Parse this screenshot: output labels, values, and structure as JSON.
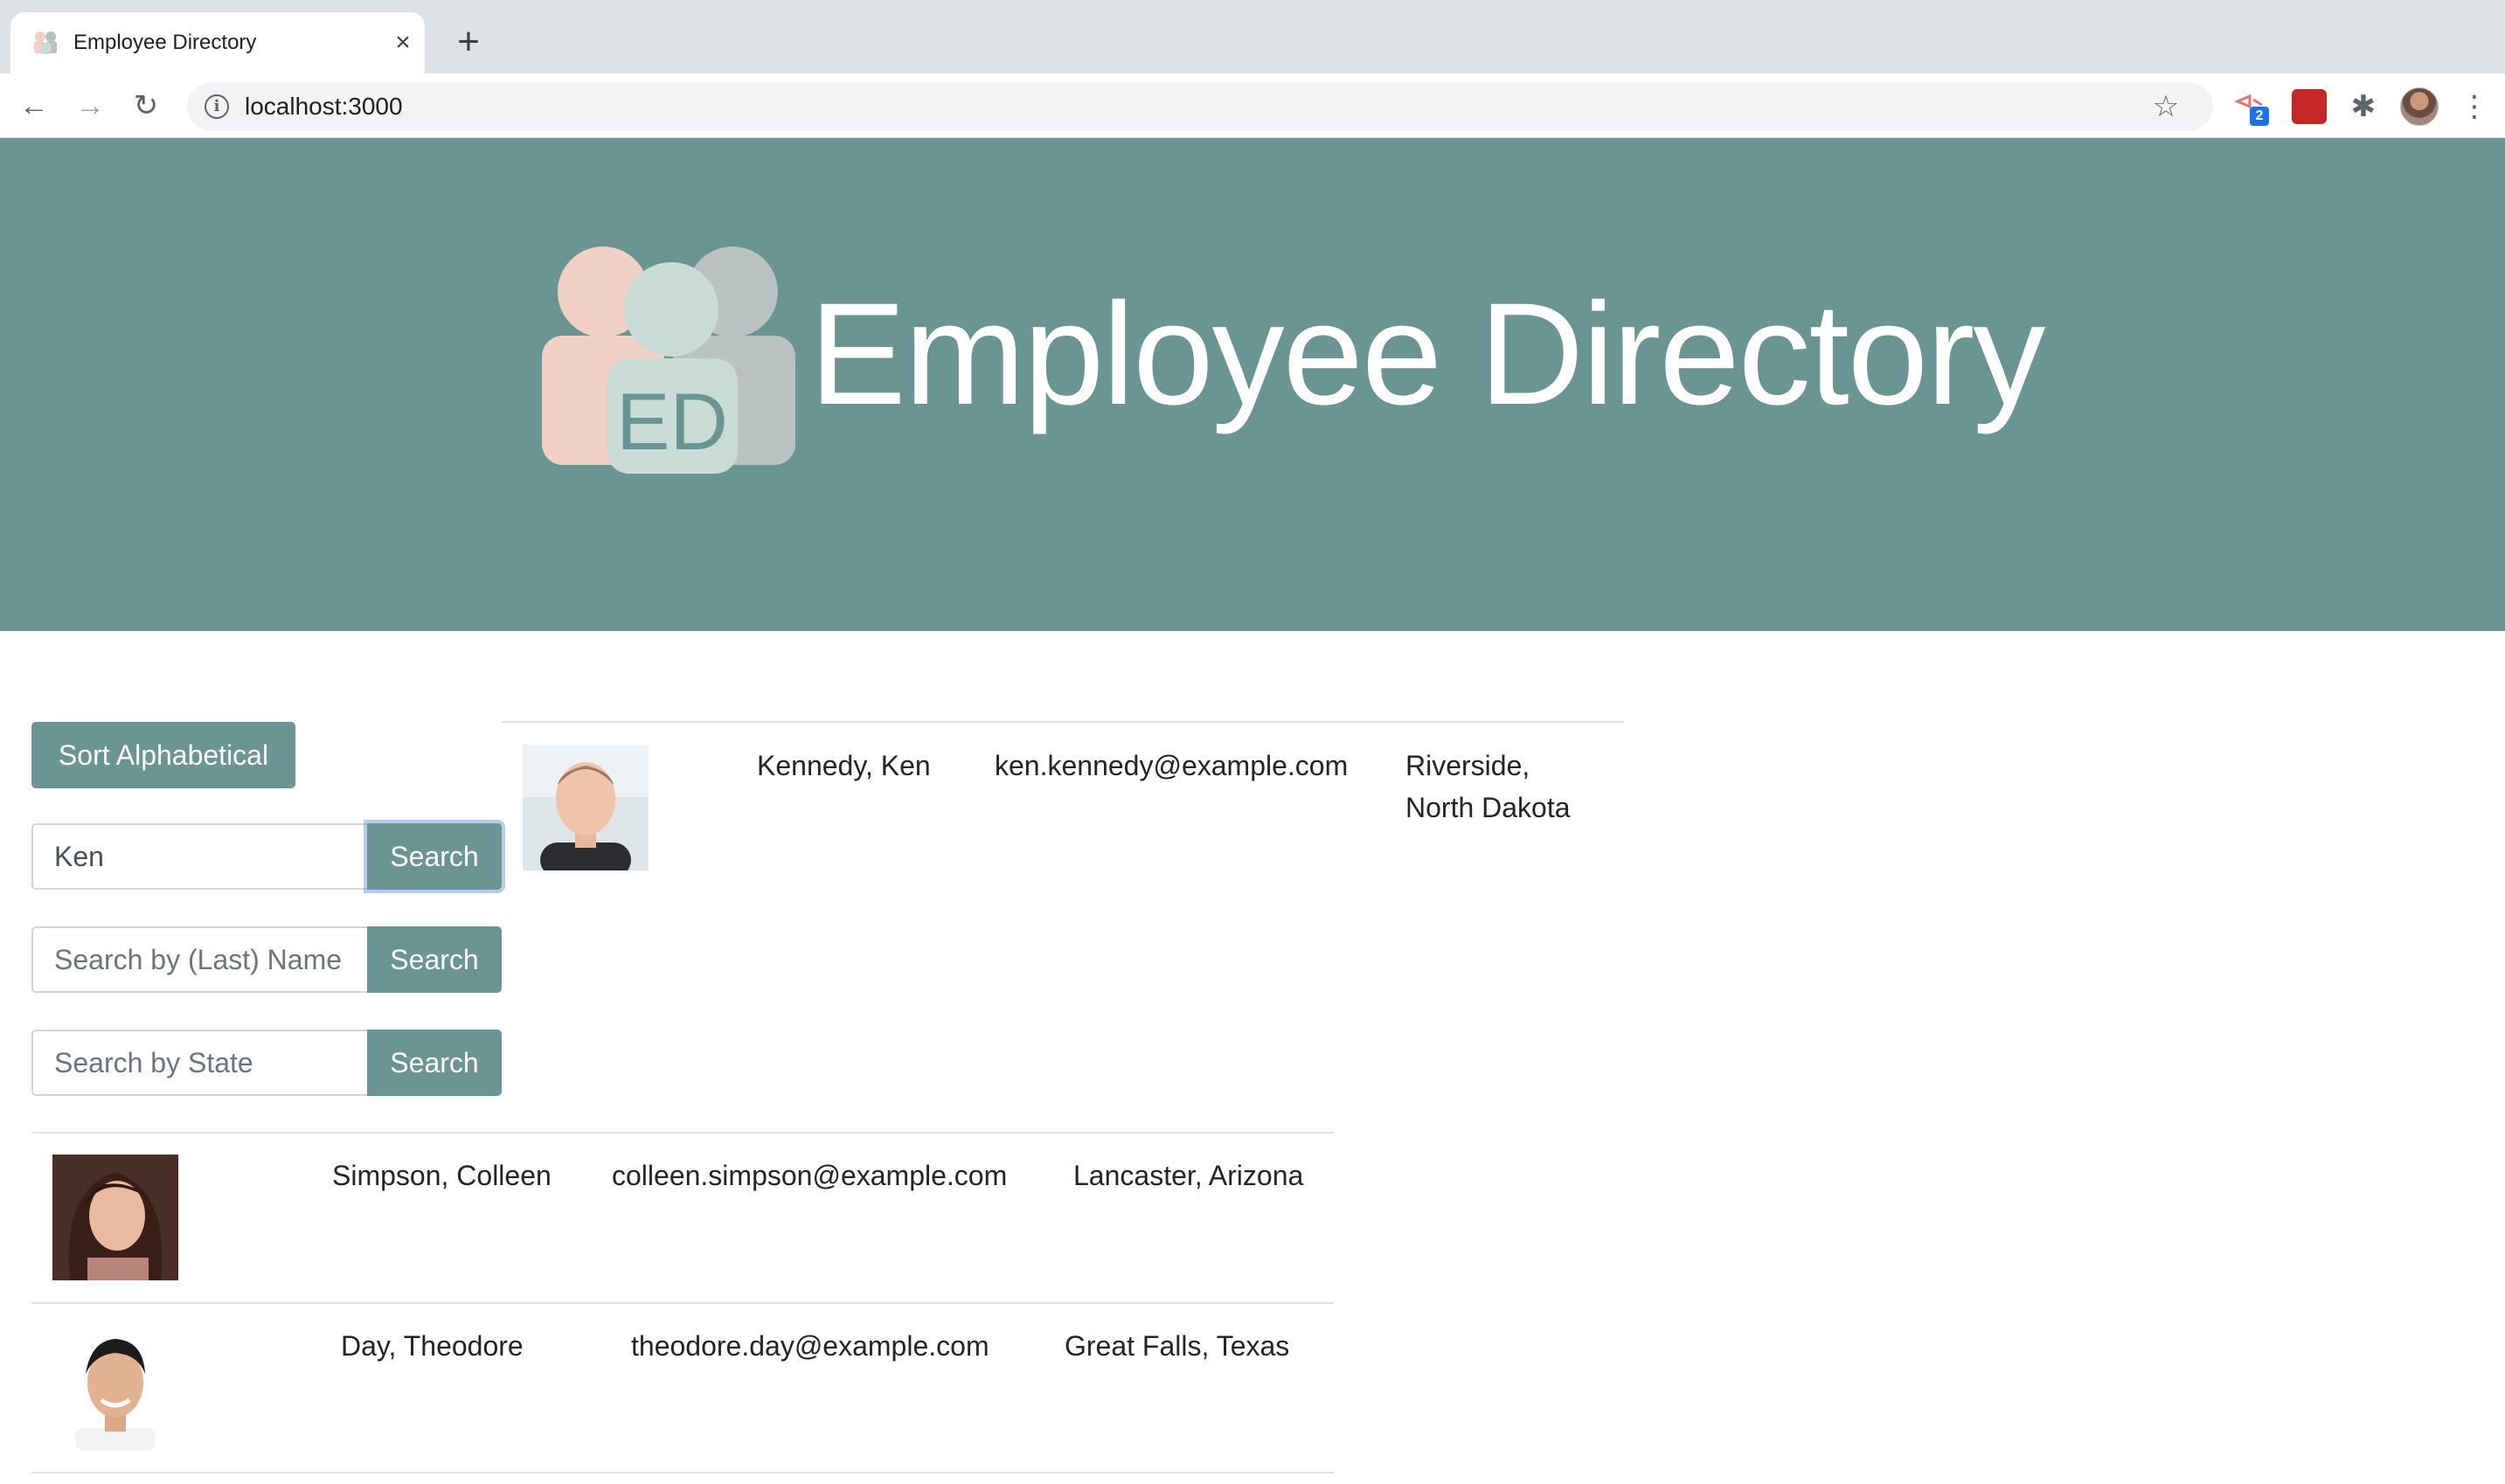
{
  "browser": {
    "tab_title": "Employee Directory",
    "url": "localhost:3000",
    "extension_badge": "2"
  },
  "colors": {
    "brand": "#6a9592",
    "logo_pink": "#f0cfc5",
    "logo_grey": "#b9c2c1",
    "logo_mint": "#c8dbd5"
  },
  "header": {
    "logo_text": "ED",
    "title": "Employee Directory"
  },
  "controls": {
    "sort_label": "Sort Alphabetical",
    "first_name_search": {
      "value": "Ken",
      "button": "Search"
    },
    "last_name_search": {
      "placeholder": "Search by (Last) Name",
      "button": "Search"
    },
    "state_search": {
      "placeholder": "Search by State",
      "button": "Search"
    }
  },
  "employees": [
    {
      "name": "Kennedy, Ken",
      "email": "ken.kennedy@example.com",
      "location": "Riverside, North Dakota"
    },
    {
      "name": "Simpson, Colleen",
      "email": "colleen.simpson@example.com",
      "location": "Lancaster, Arizona"
    },
    {
      "name": "Day, Theodore",
      "email": "theodore.day@example.com",
      "location": "Great Falls, Texas"
    }
  ]
}
